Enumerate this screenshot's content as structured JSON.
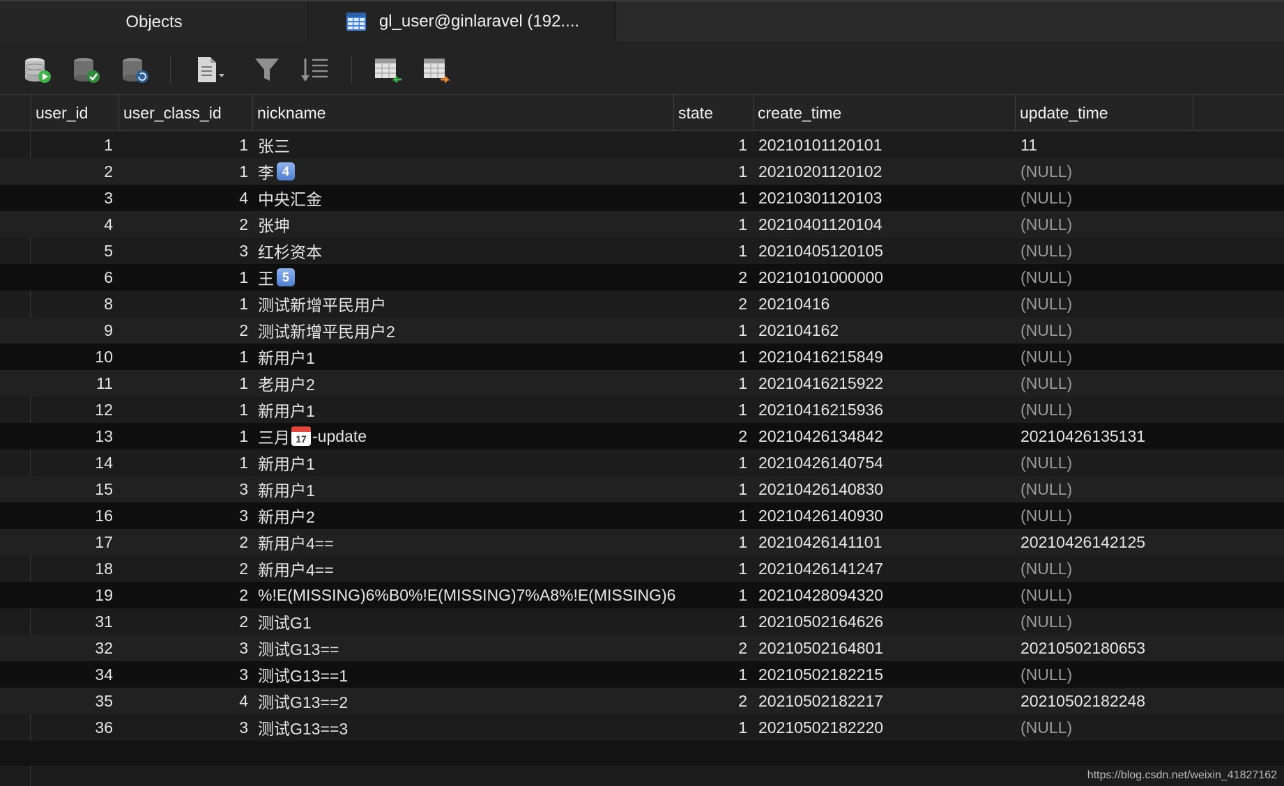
{
  "tabs": {
    "objects": "Objects",
    "table": "gl_user@ginlaravel (192...."
  },
  "toolbar": {
    "icons": [
      "db-run-icon",
      "db-commit-icon",
      "db-refresh-icon",
      "document-icon",
      "filter-icon",
      "sort-icon",
      "import-table-icon",
      "export-table-icon"
    ]
  },
  "columns": [
    "user_id",
    "user_class_id",
    "nickname",
    "state",
    "create_time",
    "update_time"
  ],
  "rows": [
    {
      "user_id": "1",
      "user_class_id": "1",
      "nickname": "张三",
      "badge": "",
      "state": "1",
      "create_time": "20210101120101",
      "update_time": "11"
    },
    {
      "user_id": "2",
      "user_class_id": "1",
      "nickname": "李",
      "badge": "4",
      "state": "1",
      "create_time": "20210201120102",
      "update_time": "(NULL)"
    },
    {
      "user_id": "3",
      "user_class_id": "4",
      "nickname": "中央汇金",
      "badge": "",
      "state": "1",
      "create_time": "20210301120103",
      "update_time": "(NULL)"
    },
    {
      "user_id": "4",
      "user_class_id": "2",
      "nickname": "张坤",
      "badge": "",
      "state": "1",
      "create_time": "20210401120104",
      "update_time": "(NULL)"
    },
    {
      "user_id": "5",
      "user_class_id": "3",
      "nickname": "红杉资本",
      "badge": "",
      "state": "1",
      "create_time": "20210405120105",
      "update_time": "(NULL)"
    },
    {
      "user_id": "6",
      "user_class_id": "1",
      "nickname": "王",
      "badge": "5",
      "state": "2",
      "create_time": "20210101000000",
      "update_time": "(NULL)"
    },
    {
      "user_id": "8",
      "user_class_id": "1",
      "nickname": "测试新增平民用户",
      "badge": "",
      "state": "2",
      "create_time": "20210416",
      "update_time": "(NULL)"
    },
    {
      "user_id": "9",
      "user_class_id": "2",
      "nickname": "测试新增平民用户2",
      "badge": "",
      "state": "1",
      "create_time": "202104162",
      "update_time": "(NULL)"
    },
    {
      "user_id": "10",
      "user_class_id": "1",
      "nickname": "新用户1",
      "badge": "",
      "state": "1",
      "create_time": "20210416215849",
      "update_time": "(NULL)"
    },
    {
      "user_id": "11",
      "user_class_id": "1",
      "nickname": "老用户2",
      "badge": "",
      "state": "1",
      "create_time": "20210416215922",
      "update_time": "(NULL)"
    },
    {
      "user_id": "12",
      "user_class_id": "1",
      "nickname": "新用户1",
      "badge": "",
      "state": "1",
      "create_time": "20210416215936",
      "update_time": "(NULL)"
    },
    {
      "user_id": "13",
      "user_class_id": "1",
      "nickname": "三月",
      "cal": "17",
      "nickname_suffix": "-update",
      "state": "2",
      "create_time": "20210426134842",
      "update_time": "20210426135131"
    },
    {
      "user_id": "14",
      "user_class_id": "1",
      "nickname": "新用户1",
      "badge": "",
      "state": "1",
      "create_time": "20210426140754",
      "update_time": "(NULL)"
    },
    {
      "user_id": "15",
      "user_class_id": "3",
      "nickname": "新用户1",
      "badge": "",
      "state": "1",
      "create_time": "20210426140830",
      "update_time": "(NULL)"
    },
    {
      "user_id": "16",
      "user_class_id": "3",
      "nickname": "新用户2",
      "badge": "",
      "state": "1",
      "create_time": "20210426140930",
      "update_time": "(NULL)"
    },
    {
      "user_id": "17",
      "user_class_id": "2",
      "nickname": "新用户4==",
      "badge": "",
      "state": "1",
      "create_time": "20210426141101",
      "update_time": "20210426142125"
    },
    {
      "user_id": "18",
      "user_class_id": "2",
      "nickname": "新用户4==",
      "badge": "",
      "state": "1",
      "create_time": "20210426141247",
      "update_time": "(NULL)"
    },
    {
      "user_id": "19",
      "user_class_id": "2",
      "nickname": "%!E(MISSING)6%B0%!E(MISSING)7%A8%!E(MISSING)6",
      "badge": "",
      "state": "1",
      "create_time": "20210428094320",
      "update_time": "(NULL)"
    },
    {
      "user_id": "31",
      "user_class_id": "2",
      "nickname": "测试G1",
      "badge": "",
      "state": "1",
      "create_time": "20210502164626",
      "update_time": "(NULL)"
    },
    {
      "user_id": "32",
      "user_class_id": "3",
      "nickname": "测试G13==",
      "badge": "",
      "state": "2",
      "create_time": "20210502164801",
      "update_time": "20210502180653"
    },
    {
      "user_id": "34",
      "user_class_id": "3",
      "nickname": "测试G13==1",
      "badge": "",
      "state": "1",
      "create_time": "20210502182215",
      "update_time": "(NULL)"
    },
    {
      "user_id": "35",
      "user_class_id": "4",
      "nickname": "测试G13==2",
      "badge": "",
      "state": "2",
      "create_time": "20210502182217",
      "update_time": "20210502182248"
    },
    {
      "user_id": "36",
      "user_class_id": "3",
      "nickname": "测试G13==3",
      "badge": "",
      "state": "1",
      "create_time": "20210502182220",
      "update_time": "(NULL)"
    }
  ],
  "watermark": "https://blog.csdn.net/weixin_41827162"
}
